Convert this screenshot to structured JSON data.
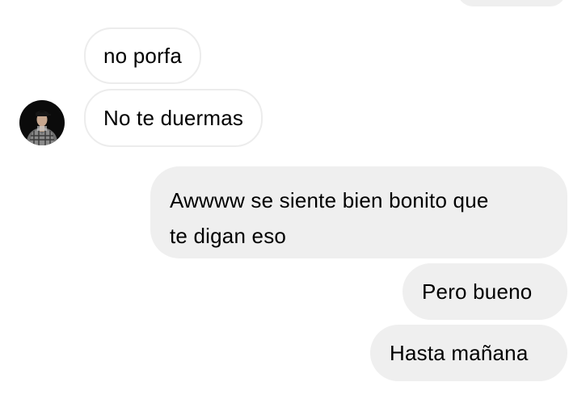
{
  "thread": {
    "incoming": [
      {
        "text": "no porfa"
      },
      {
        "text": "No te duermas"
      }
    ],
    "outgoing": [
      {
        "lines": [
          "Awwww se siente bien bonito que",
          "te digan eso"
        ]
      },
      {
        "text": "Pero bueno"
      },
      {
        "text": "Hasta mañana"
      }
    ]
  },
  "avatar": {
    "icon": "profile-photo-icon"
  },
  "colors": {
    "outgoing_bubble": "#efefef",
    "incoming_border": "#ececec",
    "text": "#000000",
    "background": "#ffffff"
  }
}
